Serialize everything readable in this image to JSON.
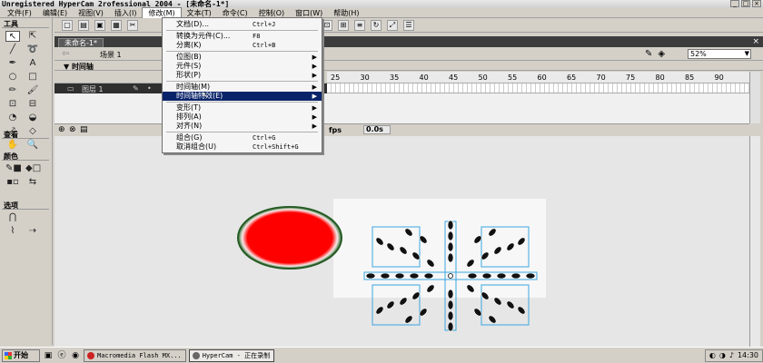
{
  "window": {
    "title": "Unregistered HyperCam 2rofessional 2004 - [未命名-1*]"
  },
  "menubar": {
    "items": [
      "文件(F)",
      "编辑(E)",
      "视图(V)",
      "插入(I)",
      "修改(M)",
      "文本(T)",
      "命令(C)",
      "控制(O)",
      "窗口(W)",
      "帮助(H)"
    ]
  },
  "tools": {
    "header": "工具",
    "view_header": "查看",
    "colors_header": "颜色",
    "options_header": "选项",
    "icons": [
      "arrow-icon",
      "subselect-icon",
      "line-icon",
      "lasso-icon",
      "pen-icon",
      "text-icon",
      "oval-icon",
      "rectangle-icon",
      "pencil-icon",
      "brush-icon",
      "free-transform-icon",
      "fill-transform-icon",
      "ink-bottle-icon",
      "paint-bucket-icon",
      "eyedropper-icon",
      "eraser-icon"
    ],
    "view_icons": [
      "hand-icon",
      "zoom-icon"
    ]
  },
  "document": {
    "tab_label": "未命名-1*",
    "scene_label": "场景 1",
    "zoom": "52%"
  },
  "timeline": {
    "header": "时间轴",
    "layer_name": "图层 1",
    "ruler_ticks": [
      "25",
      "30",
      "35",
      "40",
      "45",
      "50",
      "55",
      "60",
      "65",
      "70",
      "75",
      "80",
      "85",
      "90"
    ],
    "fps_label": "fps",
    "seconds": "0.0s"
  },
  "dropdown": {
    "items": [
      {
        "label": "文档(D)...",
        "shortcut": "Ctrl+J",
        "submenu": false
      },
      {
        "label": "转换为元件(C)...",
        "shortcut": "F8",
        "submenu": false
      },
      {
        "label": "分离(K)",
        "shortcut": "Ctrl+B",
        "submenu": false
      },
      {
        "label": "位图(B)",
        "shortcut": "",
        "submenu": true
      },
      {
        "label": "元件(S)",
        "shortcut": "",
        "submenu": true
      },
      {
        "label": "形状(P)",
        "shortcut": "",
        "submenu": true
      },
      {
        "label": "时间轴(M)",
        "shortcut": "",
        "submenu": true
      },
      {
        "label": "时间轴特效(E)",
        "shortcut": "",
        "submenu": true
      },
      {
        "label": "变形(T)",
        "shortcut": "",
        "submenu": true
      },
      {
        "label": "排列(A)",
        "shortcut": "",
        "submenu": true
      },
      {
        "label": "对齐(N)",
        "shortcut": "",
        "submenu": true
      },
      {
        "label": "组合(G)",
        "shortcut": "Ctrl+G",
        "submenu": false
      },
      {
        "label": "取消组合(U)",
        "shortcut": "Ctrl+Shift+G",
        "submenu": false
      }
    ]
  },
  "taskbar": {
    "start_label": "开始",
    "tasks": [
      "Macromedia Flash MX...",
      "HyperCam - 正在录制"
    ],
    "clock": "14:30"
  },
  "colors": {
    "circle_fill": "#ff0000",
    "circle_ring": "#2e6b2e",
    "selection_line": "#3aa7e0",
    "menu_highlight": "#0a246a"
  }
}
